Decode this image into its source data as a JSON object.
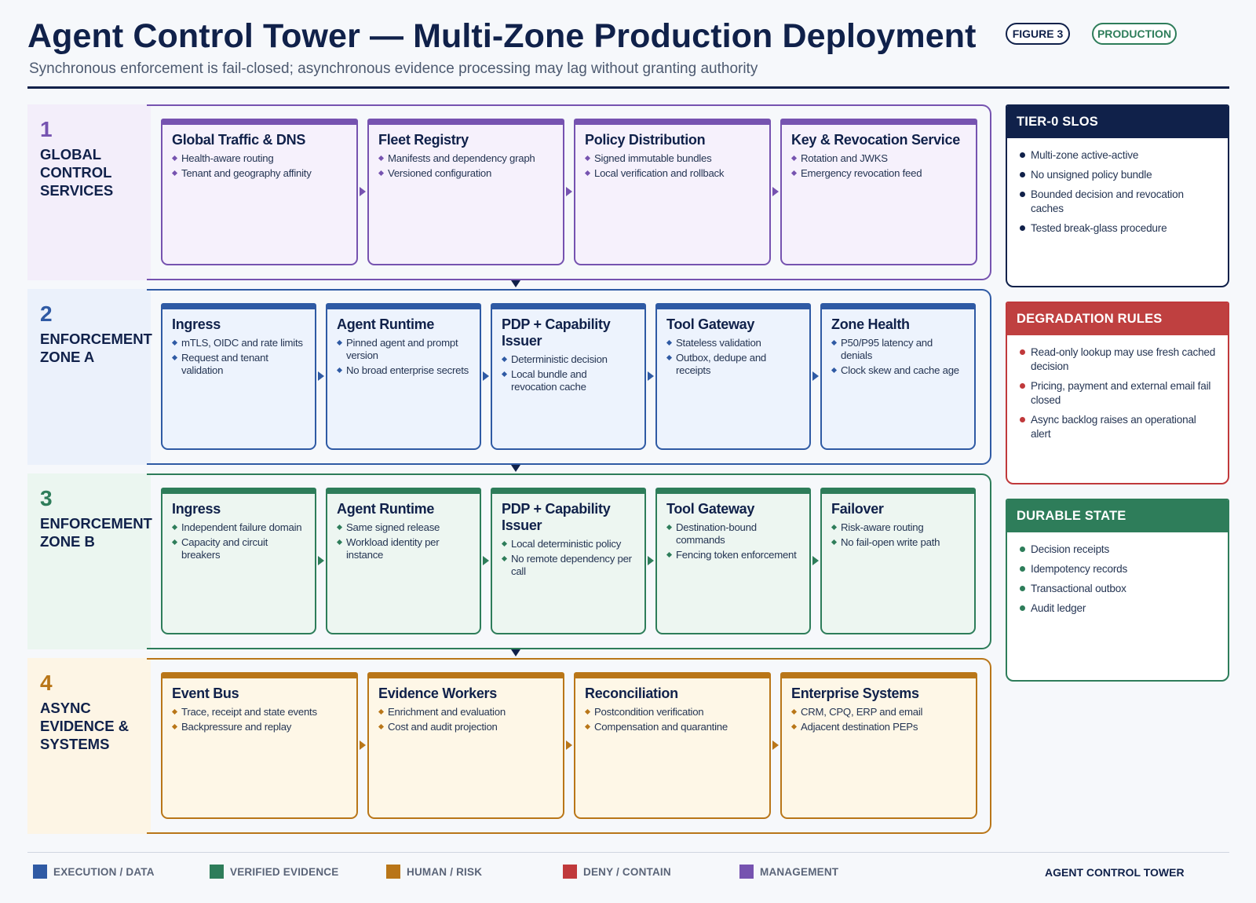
{
  "header": {
    "title": "Agent Control Tower — Multi-Zone Production Deployment",
    "subtitle": "Synchronous enforcement is fail-closed; asynchronous evidence processing may lag without granting authority",
    "figure_badge": "FIGURE 3",
    "status_badge": "PRODUCTION"
  },
  "bands": [
    {
      "number": "1",
      "name": "GLOBAL CONTROL SERVICES",
      "color": "#7653b0",
      "nodes": [
        {
          "title": "Global Traffic & DNS",
          "items": [
            "Health-aware routing",
            "Tenant and geography affinity"
          ]
        },
        {
          "title": "Fleet Registry",
          "items": [
            "Manifests and dependency graph",
            "Versioned configuration"
          ]
        },
        {
          "title": "Policy Distribution",
          "items": [
            "Signed immutable bundles",
            "Local verification and rollback"
          ]
        },
        {
          "title": "Key & Revocation Service",
          "items": [
            "Rotation and JWKS",
            "Emergency revocation feed"
          ]
        }
      ]
    },
    {
      "number": "2",
      "name": "ENFORCEMENT ZONE A",
      "color": "#2f5aa4",
      "nodes": [
        {
          "title": "Ingress",
          "items": [
            "mTLS, OIDC and rate limits",
            "Request and tenant validation"
          ]
        },
        {
          "title": "Agent Runtime",
          "items": [
            "Pinned agent and prompt version",
            "No broad enterprise secrets"
          ]
        },
        {
          "title": "PDP + Capability Issuer",
          "items": [
            "Deterministic decision",
            "Local bundle and revocation cache"
          ]
        },
        {
          "title": "Tool Gateway",
          "items": [
            "Stateless validation",
            "Outbox, dedupe and receipts"
          ]
        },
        {
          "title": "Zone Health",
          "items": [
            "P50/P95 latency and denials",
            "Clock skew and cache age"
          ]
        }
      ]
    },
    {
      "number": "3",
      "name": "ENFORCEMENT ZONE B",
      "color": "#2e7d5a",
      "nodes": [
        {
          "title": "Ingress",
          "items": [
            "Independent failure domain",
            "Capacity and circuit breakers"
          ]
        },
        {
          "title": "Agent Runtime",
          "items": [
            "Same signed release",
            "Workload identity per instance"
          ]
        },
        {
          "title": "PDP + Capability Issuer",
          "items": [
            "Local deterministic policy",
            "No remote dependency per call"
          ]
        },
        {
          "title": "Tool Gateway",
          "items": [
            "Destination-bound commands",
            "Fencing token enforcement"
          ]
        },
        {
          "title": "Failover",
          "items": [
            "Risk-aware routing",
            "No fail-open write path"
          ]
        }
      ]
    },
    {
      "number": "4",
      "name": "ASYNC EVIDENCE & SYSTEMS",
      "color": "#b97618",
      "nodes": [
        {
          "title": "Event Bus",
          "items": [
            "Trace, receipt and state events",
            "Backpressure and replay"
          ]
        },
        {
          "title": "Evidence Workers",
          "items": [
            "Enrichment and evaluation",
            "Cost and audit projection"
          ]
        },
        {
          "title": "Reconciliation",
          "items": [
            "Postcondition verification",
            "Compensation and quarantine"
          ]
        },
        {
          "title": "Enterprise Systems",
          "items": [
            "CRM, CPQ, ERP and email",
            "Adjacent destination PEPs"
          ]
        }
      ]
    }
  ],
  "sidebar": [
    {
      "title": "TIER-0 SLOS",
      "color": "#10214a",
      "items": [
        "Multi-zone active-active",
        "No unsigned policy bundle",
        "Bounded decision and revocation caches",
        "Tested break-glass procedure"
      ]
    },
    {
      "title": "DEGRADATION RULES",
      "color": "#c0393b",
      "items": [
        "Read-only lookup may use fresh cached decision",
        "Pricing, payment and external email fail closed",
        "Async backlog raises an operational alert"
      ]
    },
    {
      "title": "DURABLE STATE",
      "color": "#2e7d5a",
      "items": [
        "Decision receipts",
        "Idempotency records",
        "Transactional outbox",
        "Audit ledger"
      ]
    }
  ],
  "legend": [
    {
      "label": "EXECUTION / DATA",
      "color": "#2f5aa4"
    },
    {
      "label": "VERIFIED EVIDENCE",
      "color": "#2e7d5a"
    },
    {
      "label": "HUMAN / RISK",
      "color": "#b97618"
    },
    {
      "label": "DENY / CONTAIN",
      "color": "#c0393b"
    },
    {
      "label": "MANAGEMENT",
      "color": "#7653b0"
    }
  ],
  "footer": {
    "brand": "AGENT CONTROL TOWER"
  }
}
